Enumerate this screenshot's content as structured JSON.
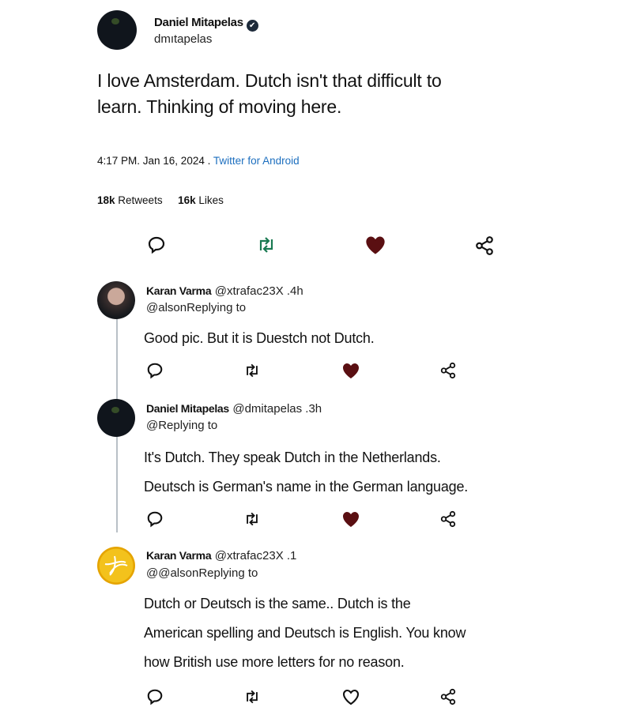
{
  "tweet": {
    "author_name": "Daniel Mitapelas",
    "author_handle": "dmıtapelas",
    "text_line1": "I love Amsterdam. Dutch isn't that difficult to",
    "text_line2": "learn. Thinking of moving here.",
    "time": "4:17 PM. Jan 16, 2024 .",
    "source": "Twitter for Android",
    "retweets_count": "18k",
    "retweets_label": "Retweets",
    "likes_count": "16k",
    "likes_label": "Likes",
    "verified_icon": "✔"
  },
  "replies": [
    {
      "name": "Karan Varma",
      "handle_time": "@xtrafac23X .4h",
      "replying": "@alsonReplying to",
      "lines": [
        "Good pic. But it is Duestch not Dutch."
      ],
      "liked": true
    },
    {
      "name": "Daniel Mitapelas",
      "handle_time": "@dmitapelas .3h",
      "replying": "@Replying to",
      "lines": [
        "It's Dutch. They speak Dutch in the Netherlands.",
        "Deutsch is German's name in the German language."
      ],
      "liked": true
    },
    {
      "name": "Karan Varma",
      "handle_time": "@xtrafac23X .1",
      "replying": "@@alsonReplying to",
      "lines": [
        "Dutch or Deutsch is the same.. Dutch is the",
        "American spelling and Deutsch is English. You know",
        "how British use more letters for no reason."
      ],
      "liked": false
    }
  ],
  "colors": {
    "like_filled": "#5a0f12",
    "retweet": "#1a7a52",
    "link": "#1d6fbf",
    "icon": "#111111"
  },
  "icons": [
    "reply-icon",
    "retweet-icon",
    "like-icon",
    "share-icon"
  ]
}
